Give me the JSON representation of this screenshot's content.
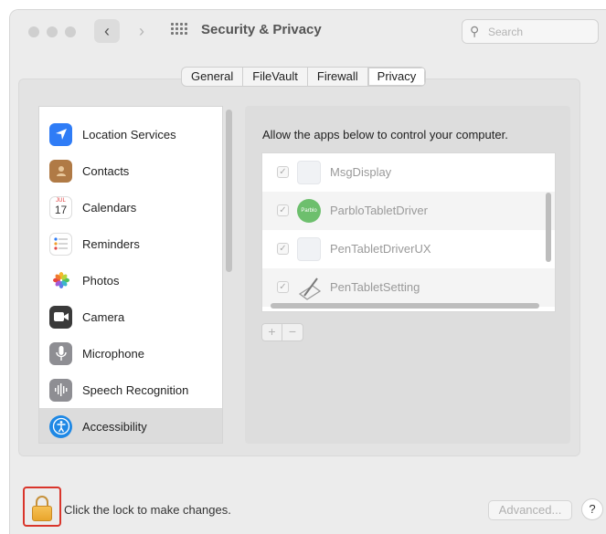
{
  "window": {
    "title": "Security & Privacy"
  },
  "search": {
    "placeholder": "Search"
  },
  "tabs": [
    {
      "label": "General"
    },
    {
      "label": "FileVault"
    },
    {
      "label": "Firewall"
    },
    {
      "label": "Privacy",
      "selected": true
    }
  ],
  "sidebar": {
    "items": [
      {
        "label": "Location Services",
        "icon": "location-arrow-icon",
        "color": "#2f7cf6"
      },
      {
        "label": "Contacts",
        "icon": "contacts-icon",
        "color": "#b07a45"
      },
      {
        "label": "Calendars",
        "icon": "calendar-icon",
        "color": "#ffffff",
        "badge_month": "JUL",
        "badge_day": "17"
      },
      {
        "label": "Reminders",
        "icon": "reminders-icon",
        "color": "#ffffff"
      },
      {
        "label": "Photos",
        "icon": "photos-icon",
        "color": "#ffffff"
      },
      {
        "label": "Camera",
        "icon": "camera-icon",
        "color": "#3a3a3a"
      },
      {
        "label": "Microphone",
        "icon": "microphone-icon",
        "color": "#8e8e93"
      },
      {
        "label": "Speech Recognition",
        "icon": "speech-waveform-icon",
        "color": "#8e8e93"
      },
      {
        "label": "Accessibility",
        "icon": "accessibility-icon",
        "color": "#1e88e5",
        "selected": true
      }
    ]
  },
  "privacy": {
    "description": "Allow the apps below to control your computer.",
    "apps": [
      {
        "name": "MsgDisplay",
        "checked": true,
        "icon": "app-placeholder-icon"
      },
      {
        "name": "ParbloTabletDriver",
        "checked": true,
        "icon": "parblo-icon",
        "icon_text": "Parblo",
        "icon_color": "#6dbf6d"
      },
      {
        "name": "PenTabletDriverUX",
        "checked": true,
        "icon": "app-placeholder-icon"
      },
      {
        "name": "PenTabletSetting",
        "checked": true,
        "icon": "pen-tablet-icon"
      }
    ],
    "add_label": "+",
    "remove_label": "−"
  },
  "footer": {
    "lock_text": "Click the lock to make changes.",
    "advanced_label": "Advanced...",
    "help_label": "?"
  },
  "check_glyph": "✓"
}
